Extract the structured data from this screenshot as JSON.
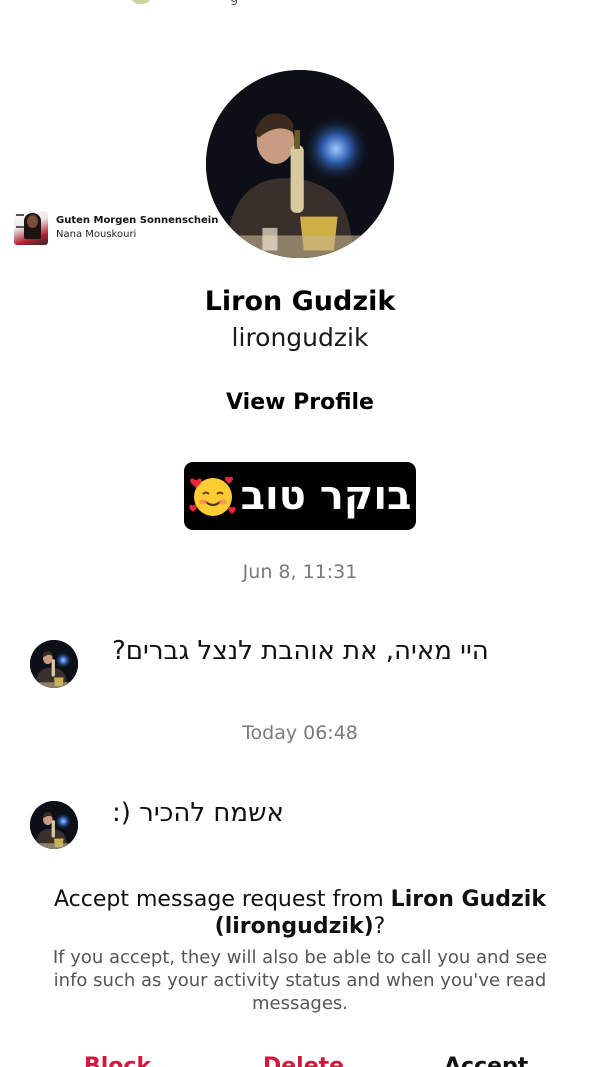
{
  "status_bar": {
    "cut_text": "g"
  },
  "music_sticker": {
    "title": "Guten Morgen Sonnenschein",
    "artist": "Nana Mouskouri"
  },
  "profile": {
    "display_name": "Liron Gudzik",
    "username": "lirongudzik",
    "view_profile_label": "View Profile"
  },
  "sticker": {
    "text": "בוקר טוב",
    "emoji": "smiling-face-with-hearts"
  },
  "thread": [
    {
      "timestamp": "Jun 8, 11:31",
      "message": "היי מאיה, את אוהבת לנצל גברים?"
    },
    {
      "timestamp": "Today 06:48",
      "message": "אשמח להכיר (:"
    }
  ],
  "request": {
    "title_prefix": "Accept message request from ",
    "title_name": "Liron Gudzik",
    "title_handle": "(lirongudzik)",
    "title_suffix": "?",
    "info": "If you accept, they will also be able to call you and see info such as your activity status and when you've read messages."
  },
  "actions": {
    "block": "Block",
    "delete": "Delete",
    "accept": "Accept"
  },
  "colors": {
    "danger": "#d4183d",
    "muted": "#7a7a7a",
    "sticker_bg": "#000000"
  }
}
